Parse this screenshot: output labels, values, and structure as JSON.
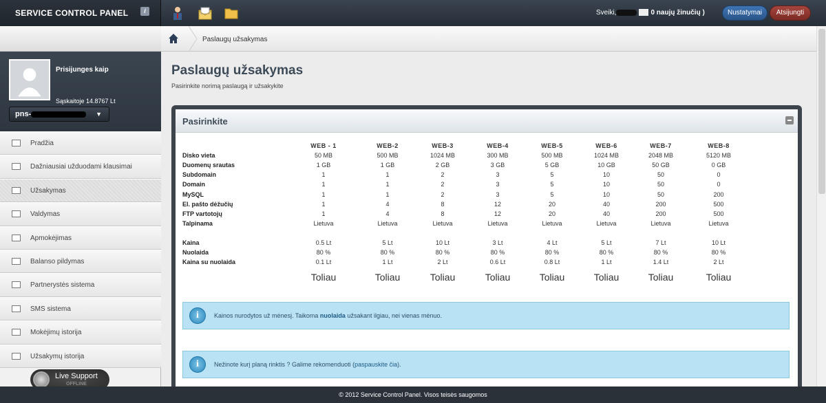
{
  "app": {
    "brand": "SERVICE CONTROL PANEL",
    "brand_badge": "i"
  },
  "topbar": {
    "greeting": "Sveiki,",
    "messages": "0 naujų žinučių )",
    "settings_label": "Nustatymai",
    "logout_label": "Atsijungti"
  },
  "profile": {
    "logged_in_label": "Prisijunges kaip",
    "balance": "Sąskaitoje 14.8767 Lt",
    "account_prefix": "pns-"
  },
  "nav": {
    "items": [
      {
        "label": "Pradžia"
      },
      {
        "label": "Dažniausiai užduodami klausimai"
      },
      {
        "label": "Užsakymas"
      },
      {
        "label": "Valdymas"
      },
      {
        "label": "Apmokėjimas"
      },
      {
        "label": "Balanso pildymas"
      },
      {
        "label": "Partnerystės sistema"
      },
      {
        "label": "SMS sistema"
      },
      {
        "label": "Mokėjimų istorija"
      },
      {
        "label": "Užsakymų istorija"
      }
    ]
  },
  "live_support": {
    "label": "Live Support",
    "status": "OFFLINE"
  },
  "breadcrumb": {
    "current": "Paslaugų užsakymas"
  },
  "page": {
    "title": "Paslaugų užsakymas",
    "subtitle": "Pasirinkite norimą paslaugą ir užsakykite"
  },
  "panel": {
    "title": "Pasirinkite"
  },
  "plans": {
    "headers": [
      "WEB - 1",
      "WEB-2",
      "WEB-3",
      "WEB-4",
      "WEB-5",
      "WEB-6",
      "WEB-7",
      "WEB-8"
    ],
    "rows": [
      {
        "label": "Disko vieta",
        "values": [
          "50 MB",
          "500 MB",
          "1024 MB",
          "300 MB",
          "500 MB",
          "1024 MB",
          "2048 MB",
          "5120 MB"
        ]
      },
      {
        "label": "Duomenų srautas",
        "values": [
          "1 GB",
          "1 GB",
          "2 GB",
          "3 GB",
          "5 GB",
          "10 GB",
          "50 GB",
          "0 GB"
        ]
      },
      {
        "label": "Subdomain",
        "values": [
          "1",
          "1",
          "2",
          "3",
          "5",
          "10",
          "50",
          "0"
        ]
      },
      {
        "label": "Domain",
        "values": [
          "1",
          "1",
          "2",
          "3",
          "5",
          "10",
          "50",
          "0"
        ]
      },
      {
        "label": "MySQL",
        "values": [
          "1",
          "1",
          "2",
          "3",
          "5",
          "10",
          "50",
          "200"
        ]
      },
      {
        "label": "El. pašto dėžučių",
        "values": [
          "1",
          "4",
          "8",
          "12",
          "20",
          "40",
          "200",
          "500"
        ]
      },
      {
        "label": "FTP vartotojų",
        "values": [
          "1",
          "4",
          "8",
          "12",
          "20",
          "40",
          "200",
          "500"
        ]
      },
      {
        "label": "Talpinama",
        "values": [
          "Lietuva",
          "Lietuva",
          "Lietuva",
          "Lietuva",
          "Lietuva",
          "Lietuva",
          "Lietuva",
          "Lietuva"
        ]
      }
    ],
    "price_rows": [
      {
        "label": "Kaina",
        "values": [
          "0.5 Lt",
          "5 Lt",
          "10 Lt",
          "3 Lt",
          "4 Lt",
          "5 Lt",
          "7 Lt",
          "10 Lt"
        ]
      },
      {
        "label": "Nuolaida",
        "values": [
          "80 %",
          "80 %",
          "80 %",
          "80 %",
          "80 %",
          "80 %",
          "80 %",
          "80 %"
        ]
      },
      {
        "label": "Kaina su nuolaida",
        "values": [
          "0.1 Lt",
          "1 Lt",
          "2 Lt",
          "0.6 Lt",
          "0.8 Lt",
          "1 Lt",
          "1.4 Lt",
          "2 Lt"
        ]
      }
    ],
    "next_label": "Toliau"
  },
  "notes": {
    "prices_pre": "Kainos nurodytos už mėnesį. Taikoma ",
    "prices_bold": "nuolaida",
    "prices_post": " užsakant ilgiau, nei vienas mėnuo.",
    "recommend_pre": "Nežinote kurį planą rinktis ? Galime rekomenduoti (",
    "recommend_link": "paspauskite čia",
    "recommend_post": ")."
  },
  "footer": {
    "text": "© 2012 Service Control Panel. Visos teisės saugomos"
  }
}
